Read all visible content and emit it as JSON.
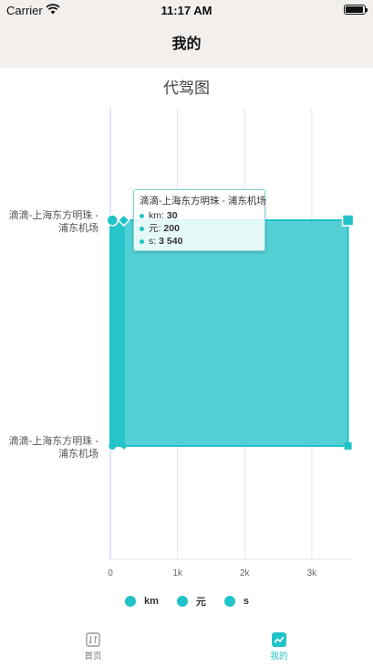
{
  "status_bar": {
    "carrier": "Carrier",
    "time": "11:17 AM"
  },
  "nav": {
    "title": "我的"
  },
  "chart_data": {
    "type": "area",
    "title": "代驾图",
    "y_categories": [
      "滴滴-上海东方明珠 - 浦东机场",
      "滴滴-上海东方明珠 - 浦东机场"
    ],
    "y_labels": [
      [
        "滴滴-上海东方明珠 -",
        "浦东机场"
      ],
      [
        "滴滴-上海东方明珠 -",
        "浦东机场"
      ]
    ],
    "x_ticks": [
      0,
      1000,
      2000,
      3000
    ],
    "x_tick_labels": [
      "0",
      "1k",
      "2k",
      "3k"
    ],
    "xlim": [
      0,
      3600
    ],
    "series": [
      {
        "name": "km",
        "values": [
          30,
          30
        ],
        "marker": "circle"
      },
      {
        "name": "元",
        "values": [
          200,
          200
        ],
        "marker": "diamond"
      },
      {
        "name": "s",
        "values": [
          3540,
          3540
        ],
        "marker": "square"
      }
    ],
    "color": "#21c3c9",
    "legend_position": "bottom",
    "tooltip": {
      "title": "滴滴-上海东方明珠 - 浦东机场",
      "rows": [
        {
          "name": "km",
          "value": "30"
        },
        {
          "name": "元",
          "value": "200"
        },
        {
          "name": "s",
          "value": "3 540"
        }
      ]
    }
  },
  "tabs": [
    {
      "label": "首页",
      "icon": "home-list-icon",
      "active": false
    },
    {
      "label": "我的",
      "icon": "chart-icon",
      "active": true,
      "color": "#21c3c9"
    }
  ]
}
